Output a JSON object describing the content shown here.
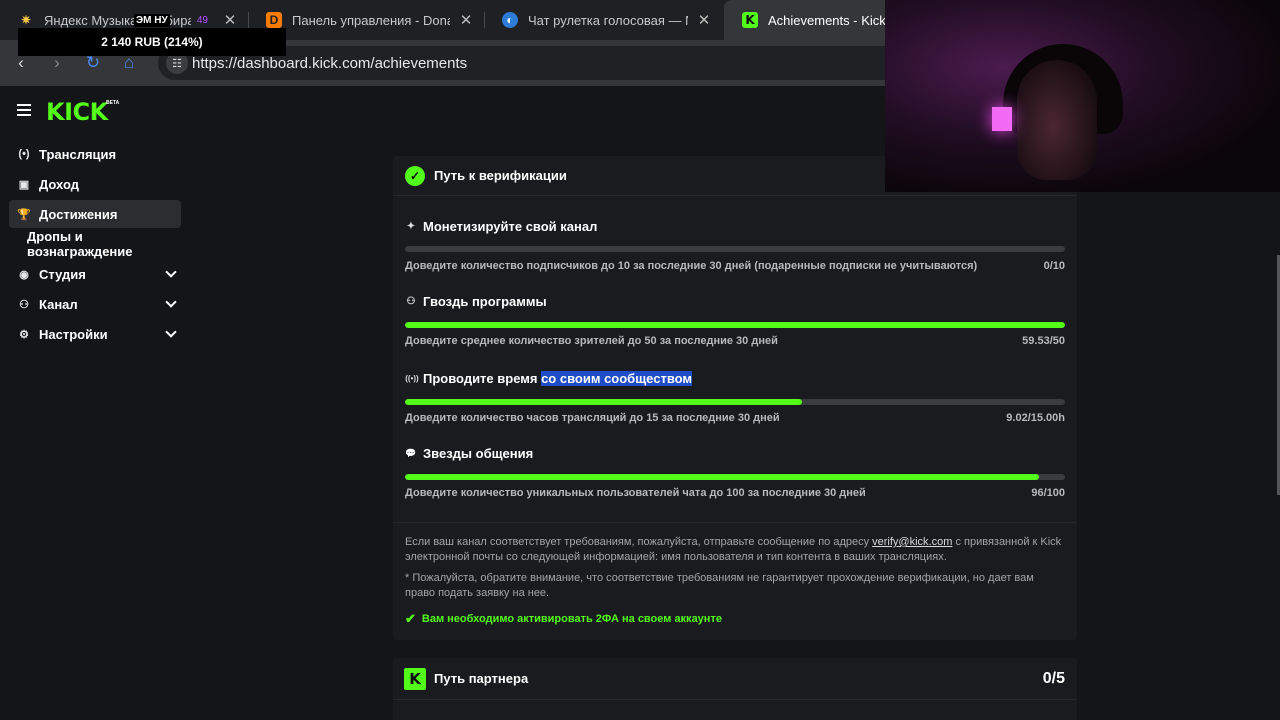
{
  "browser": {
    "tabs": [
      {
        "title": "Яндекс Музыка - Собираем",
        "favicon": "yandex-music-icon",
        "active": false
      },
      {
        "title": "Панель управления - Donation",
        "favicon": "donationalerts-icon",
        "active": false
      },
      {
        "title": "Чат рулетка голосовая — Nek",
        "favicon": "nekto-icon",
        "active": false
      },
      {
        "title": "Achievements - Kick Dashboard",
        "favicon": "kick-icon",
        "active": true
      }
    ],
    "close_glyph": "✕",
    "url": "https://dashboard.kick.com/achievements",
    "audio_badge": "49"
  },
  "overlay": {
    "label": "ЭМ НУ",
    "donation_text": "2 140 RUB (214%)"
  },
  "header": {
    "logo_text": "KICK",
    "beta_label": "BETA"
  },
  "sidebar": {
    "items": [
      {
        "label": "Трансляция",
        "icon": "broadcast-icon",
        "glyph": "(•)",
        "chevron": false,
        "active": false
      },
      {
        "label": "Доход",
        "icon": "income-icon",
        "glyph": "▣",
        "chevron": false,
        "active": false
      },
      {
        "label": "Достижения",
        "icon": "trophy-icon",
        "glyph": "🏆",
        "chevron": false,
        "active": true
      },
      {
        "label": "Дропы и вознаграждение",
        "icon": "",
        "glyph": "",
        "chevron": false,
        "active": false
      },
      {
        "label": "Студия",
        "icon": "studio-icon",
        "glyph": "◉",
        "chevron": true,
        "active": false
      },
      {
        "label": "Канал",
        "icon": "channel-icon",
        "glyph": "⚇",
        "chevron": true,
        "active": false
      },
      {
        "label": "Настройки",
        "icon": "gear-icon",
        "glyph": "⚙",
        "chevron": true,
        "active": false
      }
    ]
  },
  "verification": {
    "title": "Путь к верификации",
    "requirements": [
      {
        "title": "Монетизируйте свой канал",
        "icon": "sparkle-icon",
        "glyph": "✦",
        "description": "Доведите количество подписчиков до 10 за последние 30 дней (подаренные подписки не учитываются)",
        "value": "0/10",
        "progress": 0
      },
      {
        "title": "Гвоздь программы",
        "icon": "viewers-icon",
        "glyph": "⚇",
        "description": "Доведите среднее количество зрителей до 50 за последние 30 дней",
        "value": "59.53/50",
        "progress": 1.0
      },
      {
        "title_plain": "Проводите время ",
        "title_highlight": "со своим сообществом",
        "icon": "broadcast-icon",
        "glyph": "((•))",
        "description": "Доведите количество часов трансляций до 15 за последние 30 дней",
        "value": "9.02/15.00h",
        "progress": 0.601
      },
      {
        "title": "Звезды общения",
        "icon": "chat-icon",
        "glyph": "💬",
        "description": "Доведите количество уникальных пользователей чата до 100 за последние 30 дней",
        "value": "96/100",
        "progress": 0.96
      }
    ],
    "footer": {
      "line1_before": "Если ваш канал соответствует требованиям, пожалуйста, отправьте сообщение по адресу ",
      "email": "verify@kick.com",
      "line1_after": " с привязанной к Kick электронной почты со следующей информацией: имя пользователя и тип контента в ваших трансляциях.",
      "note": "* Пожалуйста, обратите внимание, что соответствие требованиям не гарантирует прохождение верификации, но дает вам право подать заявку на нее.",
      "twofa": "Вам необходимо активировать 2ФА на своем аккаунте"
    }
  },
  "partner": {
    "title": "Путь партнера",
    "count": "0/5"
  },
  "colors": {
    "accent": "#53fc18",
    "bg": "#141517",
    "card": "#191b1f",
    "track": "#3a3c40"
  }
}
